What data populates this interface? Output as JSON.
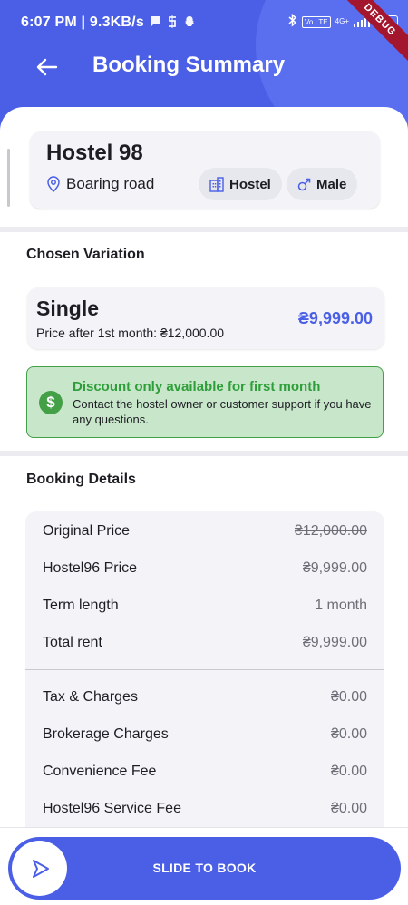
{
  "status_bar": {
    "time_speed": "6:07 PM | 9.3KB/s",
    "network": "4G+",
    "volte": "Vo LTE",
    "battery": "13",
    "debug": "DEBUG"
  },
  "header": {
    "title": "Booking Summary"
  },
  "hostel": {
    "name": "Hostel 98",
    "location": "Boaring road",
    "type_chip": "Hostel",
    "gender_chip": "Male"
  },
  "variation": {
    "section_title": "Chosen Variation",
    "name": "Single",
    "subtitle": "Price after 1st month: ₴12,000.00",
    "price": "₴9,999.00"
  },
  "discount": {
    "icon": "$",
    "title": "Discount only available for first month",
    "text": "Contact the hostel owner or customer support if you have any questions."
  },
  "booking_details": {
    "section_title": "Booking Details",
    "rows": [
      {
        "label": "Original Price",
        "value": "₴12,000.00"
      },
      {
        "label": "Hostel96 Price",
        "value": "₴9,999.00"
      },
      {
        "label": "Term length",
        "value": "1 month"
      },
      {
        "label": "Total rent",
        "value": "₴9,999.00"
      }
    ],
    "charges": [
      {
        "label": "Tax & Charges",
        "value": "₴0.00"
      },
      {
        "label": "Brokerage Charges",
        "value": "₴0.00"
      },
      {
        "label": "Convenience Fee",
        "value": "₴0.00"
      },
      {
        "label": "Hostel96 Service Fee",
        "value": "₴0.00"
      }
    ]
  },
  "slider": {
    "label": "SLIDE TO BOOK"
  },
  "colors": {
    "primary": "#4a5fe6",
    "discount_bg": "#c8e6c9",
    "discount_accent": "#43a047"
  }
}
